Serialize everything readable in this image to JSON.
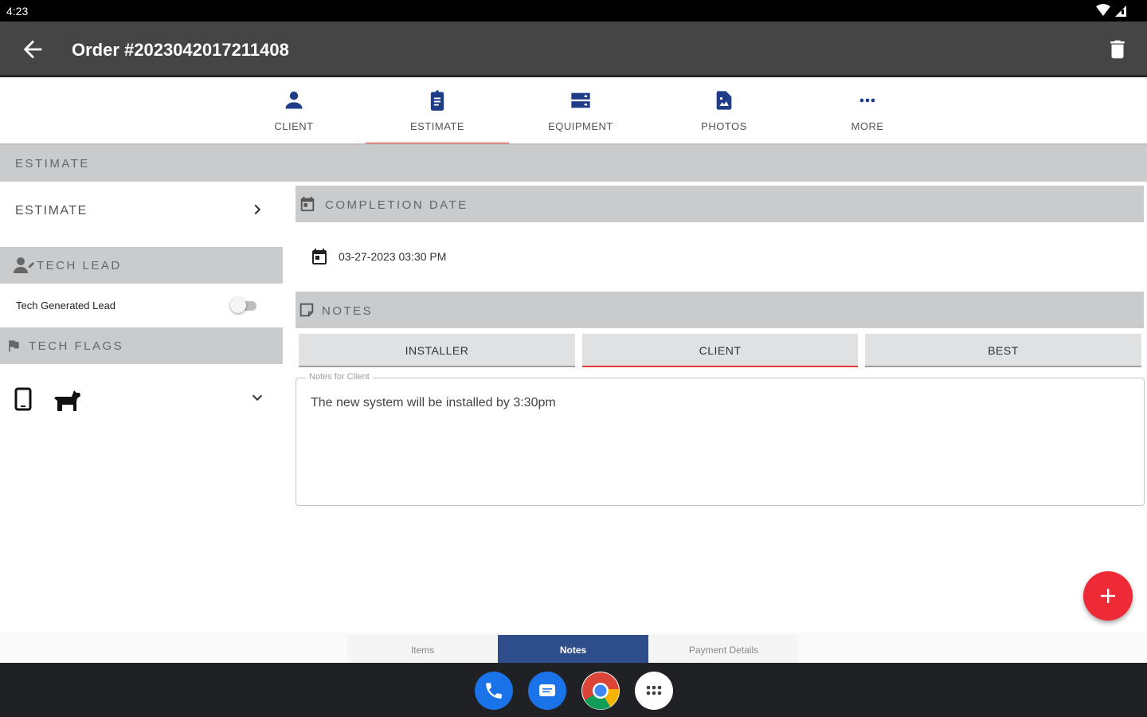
{
  "status_bar": {
    "time": "4:23"
  },
  "app_bar": {
    "title": "Order #2023042017211408"
  },
  "tabs": [
    {
      "label": "CLIENT",
      "icon": "person-icon"
    },
    {
      "label": "ESTIMATE",
      "icon": "clipboard-icon",
      "active": true
    },
    {
      "label": "EQUIPMENT",
      "icon": "storage-icon"
    },
    {
      "label": "PHOTOS",
      "icon": "image-file-icon"
    },
    {
      "label": "MORE",
      "icon": "more-horiz-icon"
    }
  ],
  "section_title": "ESTIMATE",
  "left": {
    "estimate_label": "ESTIMATE",
    "tech_lead_header": "TECH LEAD",
    "tech_generated_lead": {
      "label": "Tech Generated Lead",
      "on": false
    },
    "tech_flags_header": "TECH FLAGS"
  },
  "right": {
    "completion_date_header": "COMPLETION DATE",
    "completion_date_value": "03-27-2023 03:30 PM",
    "notes_header": "NOTES",
    "note_tabs": [
      {
        "label": "INSTALLER"
      },
      {
        "label": "CLIENT",
        "active": true
      },
      {
        "label": "BEST"
      }
    ],
    "notes_field": {
      "legend": "Notes for Client",
      "value": "The new system will be installed by 3:30pm"
    }
  },
  "bottom_tabs": [
    {
      "label": "Items"
    },
    {
      "label": "Notes",
      "active": true
    },
    {
      "label": "Payment Details"
    }
  ],
  "colors": {
    "accent": "#e53935",
    "icon_blue": "#1f3c88",
    "app_bar": "#454545",
    "section_grey": "#c9cbcd",
    "bottom_tab_active": "#2e4d8b"
  }
}
